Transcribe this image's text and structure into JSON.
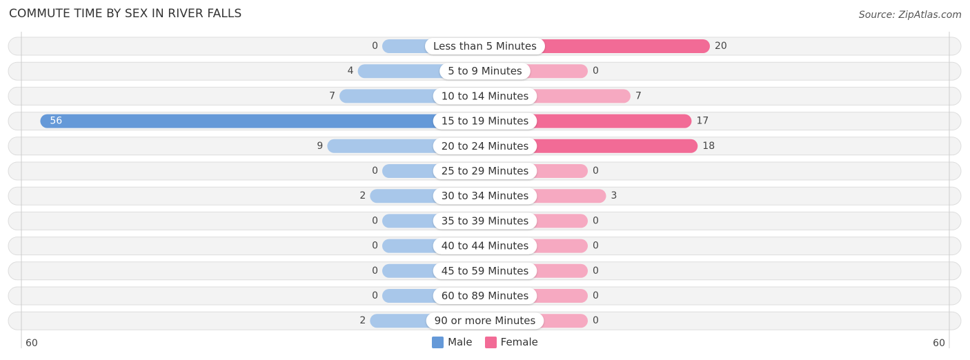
{
  "header": {
    "title": "COMMUTE TIME BY SEX IN RIVER FALLS",
    "source": "Source: ZipAtlas.com"
  },
  "colors": {
    "male_strong": "#6599d8",
    "male_light": "#a8c7ea",
    "female_strong": "#f26b96",
    "female_light": "#f6a9c1",
    "track": "#f3f3f3",
    "track_border": "#dddddd"
  },
  "chart_data": {
    "type": "bar",
    "orientation": "horizontal-diverging",
    "title": "COMMUTE TIME BY SEX IN RIVER FALLS",
    "categories": [
      "Less than 5 Minutes",
      "5 to 9 Minutes",
      "10 to 14 Minutes",
      "15 to 19 Minutes",
      "20 to 24 Minutes",
      "25 to 29 Minutes",
      "30 to 34 Minutes",
      "35 to 39 Minutes",
      "40 to 44 Minutes",
      "45 to 59 Minutes",
      "60 to 89 Minutes",
      "90 or more Minutes"
    ],
    "series": [
      {
        "name": "Male",
        "values": [
          0,
          4,
          7,
          56,
          9,
          0,
          2,
          0,
          0,
          0,
          0,
          2
        ]
      },
      {
        "name": "Female",
        "values": [
          20,
          0,
          7,
          17,
          18,
          0,
          3,
          0,
          0,
          0,
          0,
          0
        ]
      }
    ],
    "axis": {
      "left_label": "60",
      "right_label": "60",
      "range": [
        -60,
        60
      ]
    },
    "legend": {
      "position": "bottom-center",
      "entries": [
        "Male",
        "Female"
      ]
    },
    "grid": false
  }
}
